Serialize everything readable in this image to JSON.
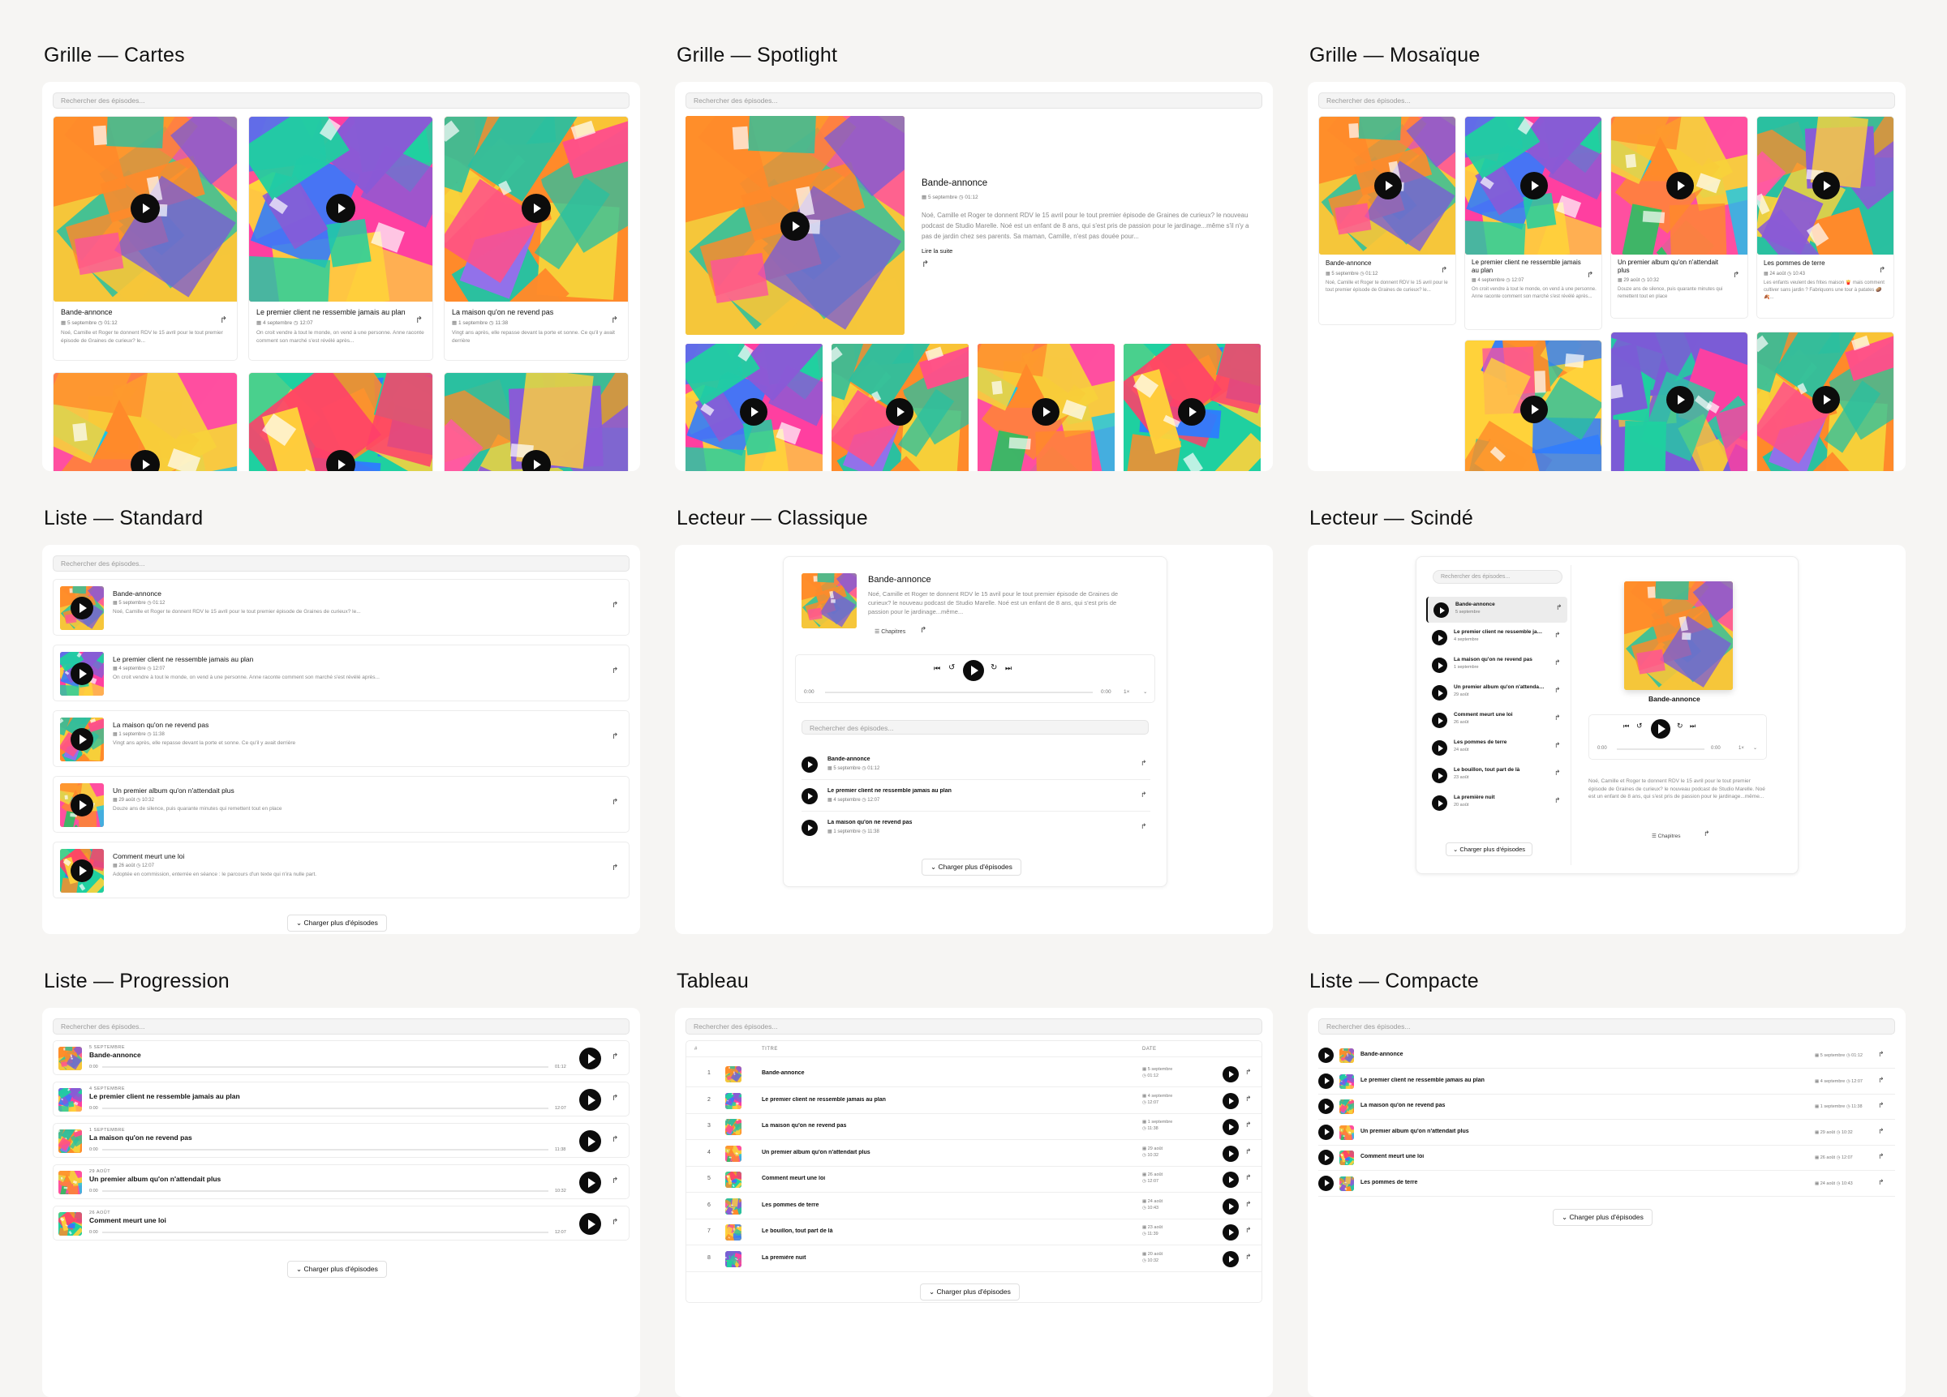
{
  "search_placeholder": "Rechercher des épisodes...",
  "load_more": "Charger plus d'épisodes",
  "chapters": "Chapitres",
  "read_more": "Lire la suite",
  "titles": {
    "grid_cards": "Grille — Cartes",
    "grid_spotlight": "Grille — Spotlight",
    "grid_mosaic": "Grille — Mosaïque",
    "list_standard": "Liste — Standard",
    "player_classic": "Lecteur — Classique",
    "player_split": "Lecteur — Scindé",
    "list_progress": "Liste — Progression",
    "table": "Tableau",
    "list_compact": "Liste — Compacte"
  },
  "table_headers": {
    "num": "#",
    "title": "TITRE",
    "date": "DATE"
  },
  "player": {
    "start": "0:00",
    "end": "0:00",
    "speed": "1×",
    "skip_back": "15",
    "skip_fwd": "15"
  },
  "episodes": [
    {
      "title": "Bande-annonce",
      "date": "5 septembre",
      "date_upper": "5 SEPTEMBRE",
      "dur": "01:12",
      "desc": "Noé, Camille et Roger te donnent RDV le 15 avril pour le tout premier épisode de Graines de curieux? le...",
      "desc_long": "Noé, Camille et Roger te donnent RDV le 15 avril pour le tout premier épisode de Graines de curieux? le nouveau podcast de Studio Marelle. Noé est un enfant de 8 ans, qui s'est pris de passion pour le jardinage...même s'il n'y a pas de jardin chez ses parents. Sa maman, Camille, n'est pas douée pour...",
      "desc_mid": "Noé, Camille et Roger te donnent RDV le 15 avril pour le tout premier épisode de Graines de curieux? le nouveau podcast de Studio Marelle. Noé est un enfant de 8 ans, qui s'est pris de passion pour le jardinage...même...",
      "colors": [
        "#f5c63a",
        "#2ac0a0",
        "#ff4fa0",
        "#7b5cd6",
        "#ff8a2a"
      ]
    },
    {
      "title": "Le premier client ne ressemble jamais au plan",
      "date": "4 septembre",
      "date_upper": "4 SEPTEMBRE",
      "dur": "12:07",
      "desc": "On croit vendre à tout le monde, on vend à une personne. Anne raconte comment son marché s'est révélé après...",
      "colors": [
        "#ff3fa0",
        "#2e7bff",
        "#ffd23a",
        "#8a5ad6",
        "#1fd0a0"
      ]
    },
    {
      "title": "La maison qu'on ne revend pas",
      "date": "1 septembre",
      "date_upper": "1 SEPTEMBRE",
      "dur": "11:38",
      "desc": "Vingt ans après, elle repasse devant la porte et sonne. Ce qu'il y avait derrière",
      "colors": [
        "#ff8a2a",
        "#ff4f8a",
        "#f7d23a",
        "#2ac0a0",
        "#9b6af0"
      ]
    },
    {
      "title": "Un premier album qu'on n'attendait plus",
      "date": "29 août",
      "date_upper": "29 AOÛT",
      "dur": "10:32",
      "desc": "Douze ans de silence, puis quarante minutes qui remettent tout en place",
      "colors": [
        "#ff4fa0",
        "#10c8f0",
        "#f7d23a",
        "#2ac060",
        "#ff8a2a"
      ]
    },
    {
      "title": "Comment meurt une loi",
      "date": "26 août",
      "date_upper": "26 AOÛT",
      "dur": "12:07",
      "desc": "Adoptée en commission, enterrée en séance : le parcours d'un texte qui n'ira nulle part.",
      "colors": [
        "#1fd0a0",
        "#ffd23a",
        "#ff3f6a",
        "#2e7bff",
        "#ff8a2a"
      ]
    },
    {
      "title": "Les pommes de terre",
      "date": "24 août",
      "date_upper": "24 AOÛT",
      "dur": "10:43",
      "desc": "Les enfants veulent des frites maison 🍟 mais comment cultiver sans jardin ? Fabriquons une tour à patates 🥔🍂...",
      "colors": [
        "#2ac0a0",
        "#ffd23a",
        "#ff5aa0",
        "#8a5ad6",
        "#ff8a2a"
      ]
    },
    {
      "title": "Le bouillon, tout part de là",
      "date": "23 août",
      "dur": "11:39",
      "colors": [
        "#ffd23a",
        "#ff4fa0",
        "#2ac0a0",
        "#2e7bff",
        "#ff8a2a"
      ]
    },
    {
      "title": "La première nuit",
      "date": "20 août",
      "dur": "10:32",
      "colors": [
        "#7b5cd6",
        "#f5c63a",
        "#1fd0a0",
        "#ff3fa0",
        "#ff8a2a"
      ]
    }
  ],
  "mosaic_extra": [
    {
      "colors": [
        "#ffd23a",
        "#ff4fa0",
        "#2ac0a0",
        "#9b6af0",
        "#ff8a2a"
      ]
    },
    {
      "colors": [
        "#ff3f6a",
        "#ffd23a",
        "#2e7bff",
        "#1fd0a0",
        "#9b6af0"
      ]
    },
    {
      "colors": [
        "#2ac060",
        "#ffd23a",
        "#ff4fa0",
        "#10c8f0",
        "#ff8a2a"
      ]
    }
  ]
}
